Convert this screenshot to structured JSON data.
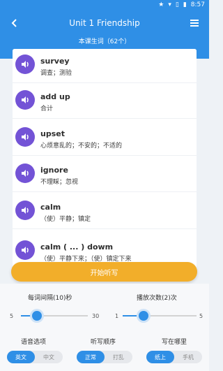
{
  "status": {
    "time": "8:57"
  },
  "header": {
    "title": "Unit 1 Friendship"
  },
  "subheader": {
    "title": "本课生词（62个）"
  },
  "words": [
    {
      "word": "survey",
      "meaning": "调查；测验"
    },
    {
      "word": "add up",
      "meaning": "合计"
    },
    {
      "word": "upset",
      "meaning": "心烦意乱的；不安的；不适的"
    },
    {
      "word": "ignore",
      "meaning": "不理睬；忽视"
    },
    {
      "word": "calm",
      "meaning": "（使）平静；镇定"
    },
    {
      "word": "calm ( ... ) dowm",
      "meaning": "（使）平静下来；（使）镇定下来"
    }
  ],
  "start_button": {
    "label": "开始听写"
  },
  "interval": {
    "label": "每词间隔(10)秒",
    "min": "5",
    "max": "30",
    "value": 10
  },
  "repeat": {
    "label": "播放次数(2)次",
    "min": "1",
    "max": "5",
    "value": 2
  },
  "language": {
    "label": "语音选项",
    "options": [
      "英文",
      "中文"
    ],
    "selected": 0
  },
  "order": {
    "label": "听写顺序",
    "options": [
      "正常",
      "打乱"
    ],
    "selected": 0
  },
  "where": {
    "label": "写在哪里",
    "options": [
      "纸上",
      "手机"
    ],
    "selected": 0
  },
  "colors": {
    "primary": "#2f8fe6",
    "accent": "#f2ae2a",
    "avatar": "#7353d6"
  }
}
